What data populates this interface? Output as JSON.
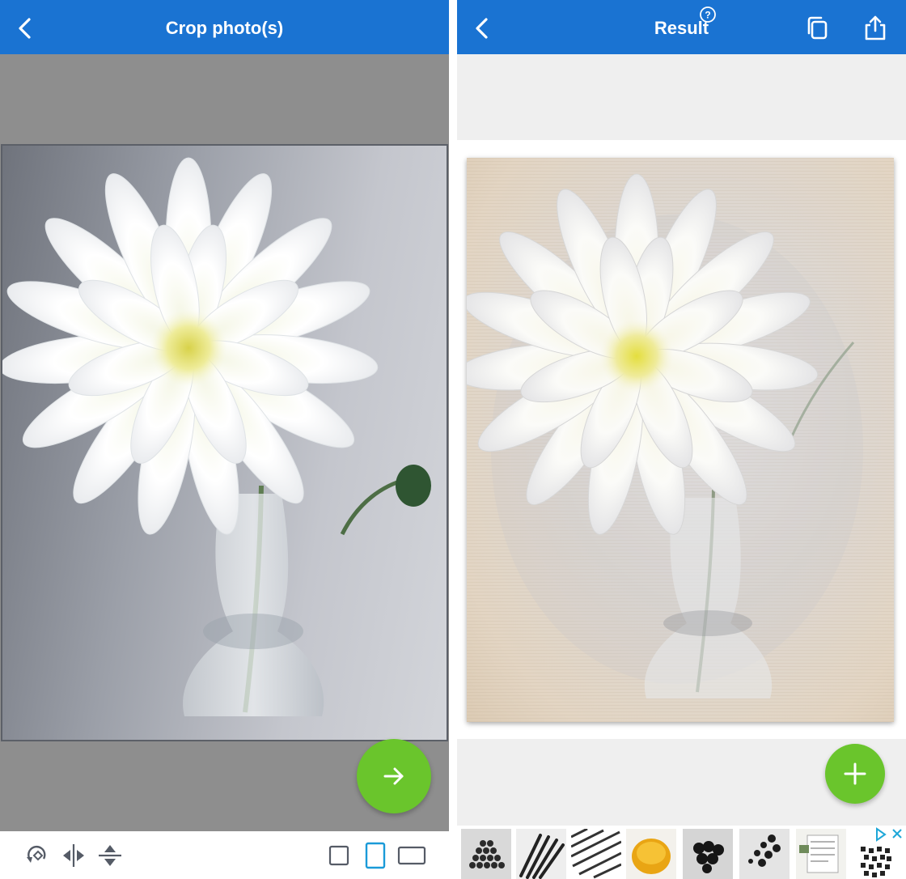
{
  "left_screen": {
    "header": {
      "title": "Crop photo(s)",
      "back_icon": "chevron-left-icon"
    },
    "next_button_icon": "arrow-right-icon",
    "toolbar": {
      "tools": [
        "rotate-icon",
        "flip-horizontal-icon",
        "flip-vertical-icon"
      ],
      "aspect_options": [
        "square-aspect-icon",
        "portrait-aspect-icon",
        "landscape-aspect-icon"
      ],
      "selected_aspect": "portrait-aspect-icon"
    }
  },
  "right_screen": {
    "header": {
      "title": "Result",
      "help_badge": "?",
      "back_icon": "chevron-left-icon",
      "actions": [
        "copy-icon",
        "share-icon"
      ]
    },
    "add_button_icon": "plus-icon",
    "ad": {
      "thumbnails": 8,
      "controls": [
        "adchoices-icon",
        "close-ad-icon"
      ]
    }
  },
  "colors": {
    "header_blue": "#1a73d2",
    "fab_green": "#6ac52c",
    "selected_outline": "#1a9ad8",
    "crop_background": "#8e8e8e",
    "result_background": "#efefef"
  }
}
